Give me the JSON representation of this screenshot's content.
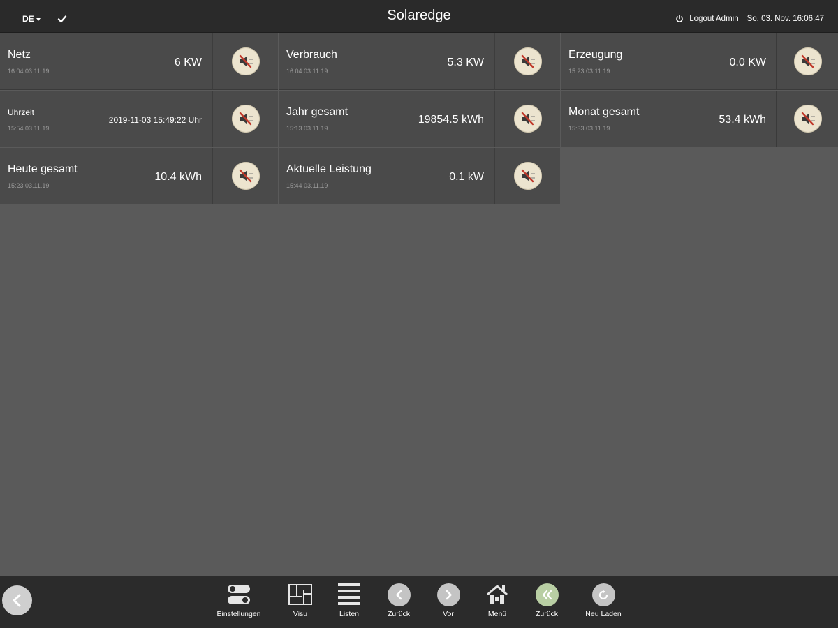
{
  "header": {
    "language": "DE",
    "title": "Solaredge",
    "logout_label": "Logout Admin",
    "datetime": "So. 03. Nov. 16:06:47"
  },
  "tiles": [
    {
      "label": "Netz",
      "stamp": "16:04 03.11.19",
      "value": "6 KW"
    },
    {
      "label": "Verbrauch",
      "stamp": "16:04 03.11.19",
      "value": "5.3 KW"
    },
    {
      "label": "Erzeugung",
      "stamp": "15:23 03.11.19",
      "value": "0.0 KW"
    },
    {
      "label": "Uhrzeit",
      "stamp": "15:54 03.11.19",
      "value": "2019-11-03 15:49:22 Uhr"
    },
    {
      "label": "Jahr gesamt",
      "stamp": "15:13 03.11.19",
      "value": "19854.5 kWh"
    },
    {
      "label": "Monat gesamt",
      "stamp": "15:33 03.11.19",
      "value": "53.4 kWh"
    },
    {
      "label": "Heute gesamt",
      "stamp": "15:23 03.11.19",
      "value": "10.4 kWh"
    },
    {
      "label": "Aktuelle Leistung",
      "stamp": "15:44 03.11.19",
      "value": "0.1 kW"
    }
  ],
  "tile_icon": "muted-speaker-icon",
  "footer": {
    "buttons": [
      {
        "label": "Einstellungen",
        "icon": "settings-toggle-icon"
      },
      {
        "label": "Visu",
        "icon": "floorplan-icon"
      },
      {
        "label": "Listen",
        "icon": "list-icon"
      },
      {
        "label": "Zurück",
        "icon": "chevron-left-icon"
      },
      {
        "label": "Vor",
        "icon": "chevron-right-icon"
      },
      {
        "label": "Menü",
        "icon": "house-icon"
      },
      {
        "label": "Zurück",
        "icon": "double-chevron-left-icon"
      },
      {
        "label": "Neu Laden",
        "icon": "reload-icon"
      }
    ]
  },
  "colors": {
    "background": "#5a5a5a",
    "tile": "#4a4a4a",
    "header": "#2a2a2a",
    "icon_disc": "#ece4cf",
    "accent_green": "#b9cfa4"
  }
}
